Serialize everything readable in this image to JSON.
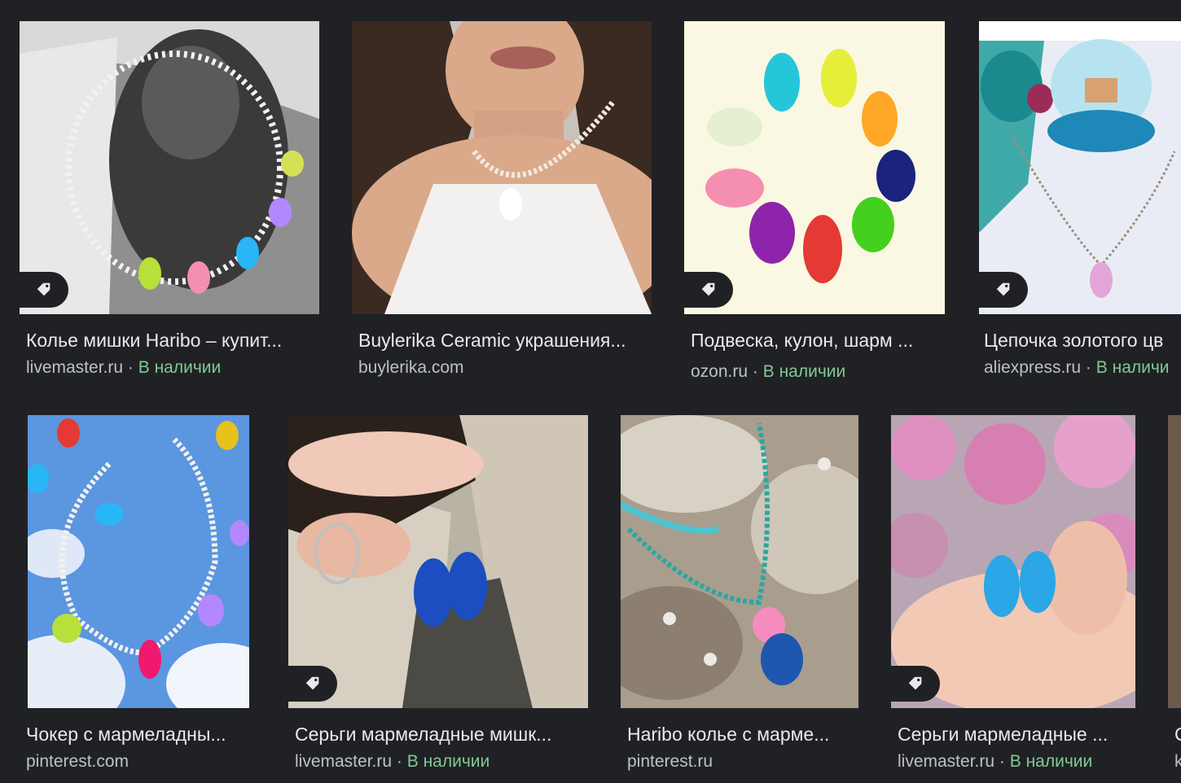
{
  "results": [
    {
      "title": "Колье мишки Haribo – купит...",
      "source": "livemaster.ru",
      "stock": "В наличии",
      "has_tag": true
    },
    {
      "title": "Buylerika Ceramic украшения...",
      "source": "buylerika.com",
      "stock": "",
      "has_tag": false
    },
    {
      "title": "Подвеска, кулон, шарм ...",
      "source": "ozon.ru",
      "stock": "В наличии",
      "has_tag": true
    },
    {
      "title": "Цепочка золотого цв",
      "source": "aliexpress.ru",
      "stock": "В наличи",
      "has_tag": true
    },
    {
      "title": "Чокер с мармеладны...",
      "source": "pinterest.com",
      "stock": "",
      "has_tag": false
    },
    {
      "title": "Серьги мармеладные мишк...",
      "source": "livemaster.ru",
      "stock": "В наличии",
      "has_tag": true
    },
    {
      "title": "Haribo колье с марме...",
      "source": "pinterest.ru",
      "stock": "",
      "has_tag": false
    },
    {
      "title": "Серьги мармеладные ...",
      "source": "livemaster.ru",
      "stock": "В наличии",
      "has_tag": true
    },
    {
      "title": "С",
      "source": "k",
      "stock": "",
      "has_tag": false
    }
  ],
  "separator": "·",
  "icons": {
    "tag": "shopping-tag-icon"
  },
  "colors": {
    "background": "#202124",
    "title": "#e8eaed",
    "source": "#bdc1c6",
    "stock": "#81c995"
  }
}
